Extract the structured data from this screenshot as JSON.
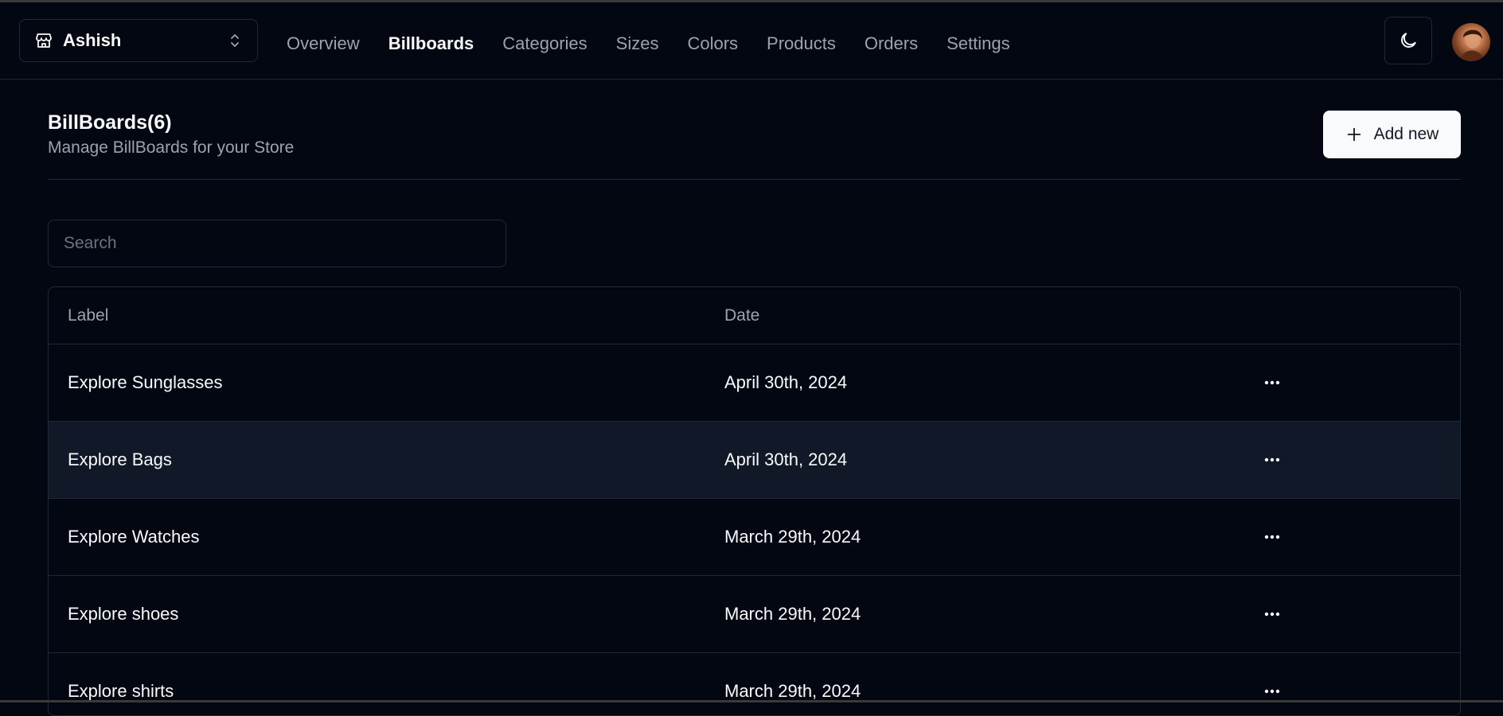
{
  "store": {
    "name": "Ashish"
  },
  "nav": {
    "links": [
      {
        "label": "Overview",
        "active": false
      },
      {
        "label": "Billboards",
        "active": true
      },
      {
        "label": "Categories",
        "active": false
      },
      {
        "label": "Sizes",
        "active": false
      },
      {
        "label": "Colors",
        "active": false
      },
      {
        "label": "Products",
        "active": false
      },
      {
        "label": "Orders",
        "active": false
      },
      {
        "label": "Settings",
        "active": false
      }
    ]
  },
  "header": {
    "title": "BillBoards(6)",
    "subtitle": "Manage BillBoards for your Store",
    "add_button_label": "Add new"
  },
  "search": {
    "placeholder": "Search",
    "value": ""
  },
  "table": {
    "columns": [
      "Label",
      "Date"
    ],
    "rows": [
      {
        "label": "Explore Sunglasses",
        "date": "April 30th, 2024"
      },
      {
        "label": "Explore Bags",
        "date": "April 30th, 2024"
      },
      {
        "label": "Explore Watches",
        "date": "March 29th, 2024"
      },
      {
        "label": "Explore shoes",
        "date": "March 29th, 2024"
      },
      {
        "label": "Explore shirts",
        "date": "March 29th, 2024"
      }
    ]
  },
  "icons": {
    "store": "store-icon",
    "switcher": "chevrons-up-down-icon",
    "theme": "moon-icon",
    "add": "plus-icon",
    "row_action": "more-horizontal-icon"
  },
  "colors": {
    "background": "#030712",
    "border": "#1f2937",
    "muted_text": "#9ca3af",
    "primary_text": "#f9fafb",
    "button_bg": "#f9fafb",
    "hover_row": "#111827"
  }
}
